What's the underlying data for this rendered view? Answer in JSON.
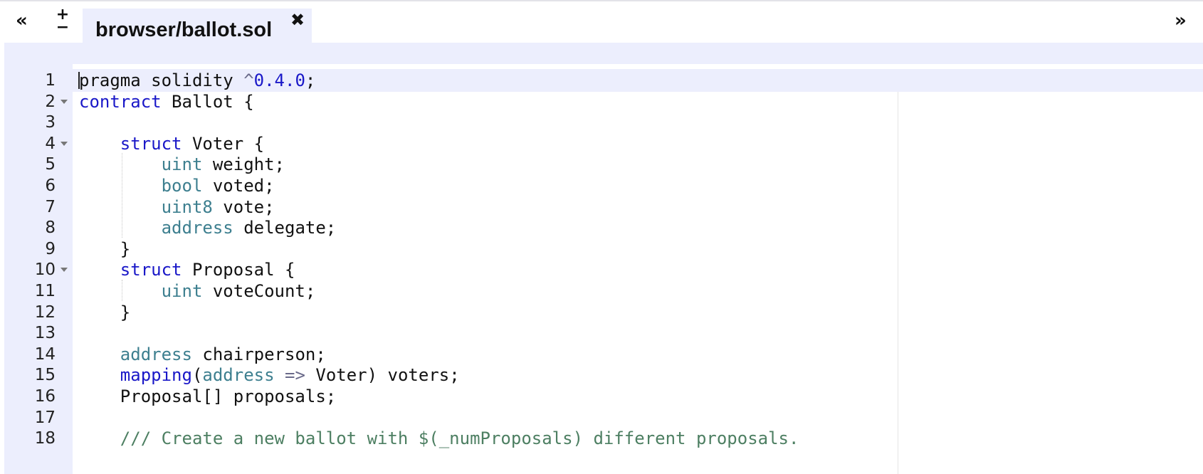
{
  "tabbar": {
    "left_arrow": "«",
    "zoom_plus": "+",
    "zoom_minus": "−",
    "active_tab": {
      "title": "browser/ballot.sol",
      "close": "✖"
    },
    "right_arrow": "»"
  },
  "editor": {
    "language": "solidity",
    "lines": [
      {
        "num": "1",
        "text": "pragma solidity ^0.4.0;"
      },
      {
        "num": "2",
        "text": "contract Ballot {"
      },
      {
        "num": "3",
        "text": ""
      },
      {
        "num": "4",
        "text": "    struct Voter {"
      },
      {
        "num": "5",
        "text": "        uint weight;"
      },
      {
        "num": "6",
        "text": "        bool voted;"
      },
      {
        "num": "7",
        "text": "        uint8 vote;"
      },
      {
        "num": "8",
        "text": "        address delegate;"
      },
      {
        "num": "9",
        "text": "    }"
      },
      {
        "num": "10",
        "text": "    struct Proposal {"
      },
      {
        "num": "11",
        "text": "        uint voteCount;"
      },
      {
        "num": "12",
        "text": "    }"
      },
      {
        "num": "13",
        "text": ""
      },
      {
        "num": "14",
        "text": "    address chairperson;"
      },
      {
        "num": "15",
        "text": "    mapping(address => Voter) voters;"
      },
      {
        "num": "16",
        "text": "    Proposal[] proposals;"
      },
      {
        "num": "17",
        "text": ""
      },
      {
        "num": "18",
        "text": "    /// Create a new ballot with $(_numProposals) different proposals."
      }
    ]
  },
  "colors": {
    "background": "#ffffff",
    "gutter": "#eceefd",
    "tab": "#eceefd",
    "keyword": "#1a18c8",
    "type": "#3d7f8f",
    "comment": "#4d7f62",
    "text": "#111111"
  },
  "icons": {
    "left_arrow": "double-chevron-left-icon",
    "zoom": "plus-minus-icon",
    "close": "close-icon",
    "right_arrow": "double-chevron-right-icon",
    "fold": "fold-caret-icon"
  }
}
